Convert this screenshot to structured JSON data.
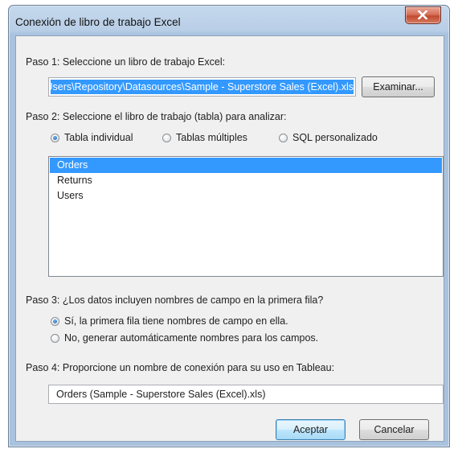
{
  "window": {
    "title": "Conexión de libro de trabajo Excel"
  },
  "step1": {
    "label": "Paso 1: Seleccione un libro de trabajo Excel:",
    "path_value": "C:\\Users\\Repository\\Datasources\\Sample - Superstore Sales (Excel).xls",
    "browse_label": "Examinar..."
  },
  "step2": {
    "label": "Paso 2: Seleccione el libro de trabajo (tabla) para analizar:",
    "options": [
      {
        "label": "Tabla individual",
        "checked": true
      },
      {
        "label": "Tablas múltiples",
        "checked": false
      },
      {
        "label": "SQL personalizado",
        "checked": false
      }
    ],
    "tables": [
      "Orders",
      "Returns",
      "Users"
    ],
    "selected_table": "Orders"
  },
  "step3": {
    "label": "Paso 3: ¿Los datos incluyen nombres de campo en la primera fila?",
    "options": [
      {
        "label": "Sí, la primera fila tiene nombres de campo en ella.",
        "checked": true
      },
      {
        "label": "No, generar automáticamente nombres para los campos.",
        "checked": false
      }
    ]
  },
  "step4": {
    "label": "Paso 4: Proporcione un nombre de conexión para su uso en Tableau:",
    "connection_name": "Orders (Sample - Superstore Sales (Excel).xls)"
  },
  "buttons": {
    "ok": "Aceptar",
    "cancel": "Cancelar"
  },
  "colors": {
    "selection": "#3399ff",
    "close_button": "#c94a2f",
    "title_bar": "#b9cfe7"
  }
}
